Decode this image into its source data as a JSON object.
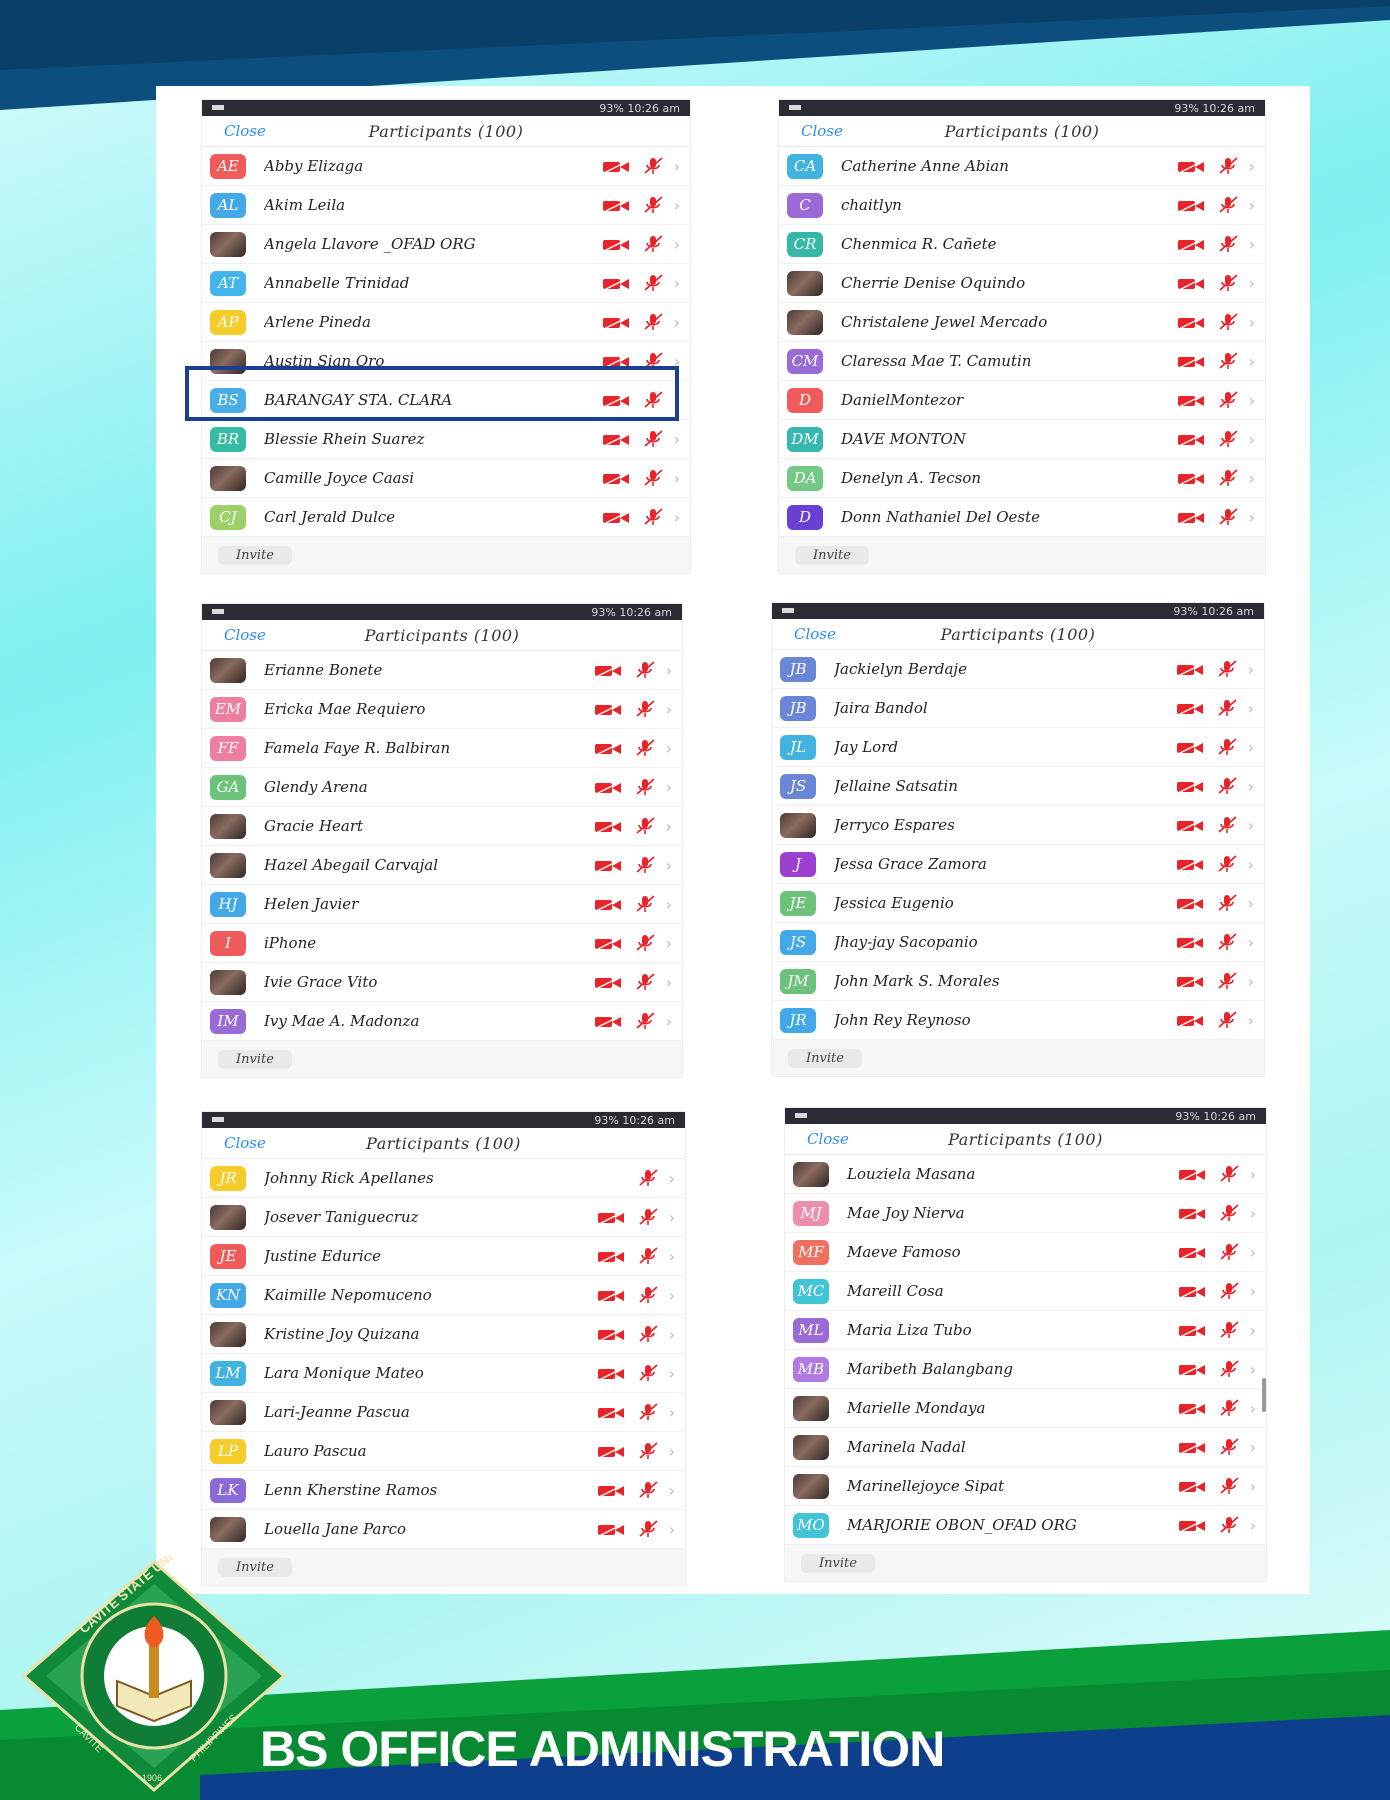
{
  "footer_title": "BS OFFICE ADMINISTRATION",
  "logo": {
    "ring_text_top": "CAVITE STATE UNIVERSITY",
    "ring_text_bottom_left": "CAVITE",
    "ring_text_bottom_right": "PHILIPPINES",
    "year": "1906"
  },
  "colors": {
    "video_icon": "#e8242b",
    "mic_icon": "#e8242b",
    "close_link": "#2d8cf0",
    "highlight_border": "#1b3f8f",
    "status_bar": "#2b2b33"
  },
  "panels": [
    {
      "status": "93% 10:26 am",
      "close_label": "Close",
      "title": "Participants (100)",
      "invite_label": "Invite",
      "participants": [
        {
          "initials": "AE",
          "color": "#ef5b5b",
          "name": "Abby Elizaga",
          "video": true
        },
        {
          "initials": "AL",
          "color": "#42a8e8",
          "name": "Akim Leila",
          "video": true
        },
        {
          "initials": "",
          "color": "photo",
          "name": "Angela Llavore _OFAD ORG",
          "video": true
        },
        {
          "initials": "AT",
          "color": "#42b6ec",
          "name": "Annabelle Trinidad",
          "video": true
        },
        {
          "initials": "AP",
          "color": "#f6cc2b",
          "name": "Arlene Pineda",
          "video": true
        },
        {
          "initials": "",
          "color": "photo",
          "name": "Austin Sian Oro",
          "video": true
        },
        {
          "initials": "BS",
          "color": "#4aaee6",
          "name": "BARANGAY STA. CLARA",
          "video": true
        },
        {
          "initials": "BR",
          "color": "#36bba4",
          "name": "Blessie Rhein Suarez",
          "video": true
        },
        {
          "initials": "",
          "color": "photo",
          "name": "Camille Joyce Caasi",
          "video": true
        },
        {
          "initials": "CJ",
          "color": "#9ed06a",
          "name": "Carl Jerald Dulce",
          "video": true
        }
      ]
    },
    {
      "status": "93% 10:26 am",
      "close_label": "Close",
      "title": "Participants (100)",
      "invite_label": "Invite",
      "participants": [
        {
          "initials": "CA",
          "color": "#42b3e0",
          "name": "Catherine Anne Abian",
          "video": true
        },
        {
          "initials": "C",
          "color": "#9c6ad6",
          "name": "chaitlyn",
          "video": true
        },
        {
          "initials": "CR",
          "color": "#36b8a8",
          "name": "Chenmica R. Cañete",
          "video": true
        },
        {
          "initials": "",
          "color": "photo",
          "name": "Cherrie Denise Oquindo",
          "video": true
        },
        {
          "initials": "",
          "color": "photo",
          "name": "Christalene Jewel Mercado",
          "video": true
        },
        {
          "initials": "CM",
          "color": "#9a6ad6",
          "name": "Claressa Mae T. Camutin",
          "video": true
        },
        {
          "initials": "D",
          "color": "#ef5b5b",
          "name": "DanielMontezor",
          "video": true
        },
        {
          "initials": "DM",
          "color": "#36b8b0",
          "name": "DAVE MONTON",
          "video": true
        },
        {
          "initials": "DA",
          "color": "#76c886",
          "name": "Denelyn A. Tecson",
          "video": true
        },
        {
          "initials": "D",
          "color": "#6a3fd6",
          "name": "Donn Nathaniel Del Oeste",
          "video": true
        }
      ]
    },
    {
      "status": "93% 10:26 am",
      "close_label": "Close",
      "title": "Participants (100)",
      "invite_label": "Invite",
      "participants": [
        {
          "initials": "",
          "color": "photo",
          "name": "Erianne Bonete",
          "video": true
        },
        {
          "initials": "EM",
          "color": "#ee7ea0",
          "name": "Ericka Mae Requiero",
          "video": true
        },
        {
          "initials": "FF",
          "color": "#ee7ea0",
          "name": "Famela Faye R. Balbiran",
          "video": true
        },
        {
          "initials": "GA",
          "color": "#6cc27a",
          "name": "Glendy Arena",
          "video": true
        },
        {
          "initials": "",
          "color": "photo",
          "name": "Gracie Heart",
          "video": true
        },
        {
          "initials": "",
          "color": "photo",
          "name": "Hazel Abegail Carvajal",
          "video": true
        },
        {
          "initials": "HJ",
          "color": "#42a8e8",
          "name": "Helen Javier",
          "video": true
        },
        {
          "initials": "I",
          "color": "#ef5b5b",
          "name": "iPhone",
          "video": true
        },
        {
          "initials": "",
          "color": "photo",
          "name": "Ivie Grace Vito",
          "video": true
        },
        {
          "initials": "IM",
          "color": "#9a6ad6",
          "name": "Ivy Mae A. Madonza",
          "video": true
        }
      ]
    },
    {
      "status": "93% 10:26 am",
      "close_label": "Close",
      "title": "Participants (100)",
      "invite_label": "Invite",
      "participants": [
        {
          "initials": "JB",
          "color": "#6a86d6",
          "name": "Jackielyn Berdaje",
          "video": true
        },
        {
          "initials": "JB",
          "color": "#6a86d6",
          "name": "Jaira Bandol",
          "video": true
        },
        {
          "initials": "JL",
          "color": "#42b3e0",
          "name": "Jay Lord",
          "video": true
        },
        {
          "initials": "JS",
          "color": "#6a86d6",
          "name": "Jellaine Satsatin",
          "video": true
        },
        {
          "initials": "",
          "color": "photo",
          "name": "Jerryco Espares",
          "video": true
        },
        {
          "initials": "J",
          "color": "#9a3fd0",
          "name": "Jessa Grace Zamora",
          "video": true
        },
        {
          "initials": "JE",
          "color": "#6cc27a",
          "name": "Jessica Eugenio",
          "video": true
        },
        {
          "initials": "JS",
          "color": "#42a8e8",
          "name": "Jhay-jay Sacopanio",
          "video": true
        },
        {
          "initials": "JM",
          "color": "#6cc27a",
          "name": "John Mark S. Morales",
          "video": true
        },
        {
          "initials": "JR",
          "color": "#42a8e8",
          "name": "John Rey Reynoso",
          "video": true
        }
      ]
    },
    {
      "status": "93% 10:26 am",
      "close_label": "Close",
      "title": "Participants (100)",
      "invite_label": "Invite",
      "participants": [
        {
          "initials": "JR",
          "color": "#f6cc2b",
          "name": "Johnny Rick Apellanes",
          "video": false
        },
        {
          "initials": "",
          "color": "photo",
          "name": "Josever Taniguecruz",
          "video": true
        },
        {
          "initials": "JE",
          "color": "#ef5b5b",
          "name": "Justine Edurice",
          "video": true
        },
        {
          "initials": "KN",
          "color": "#42a8e8",
          "name": "Kaimille Nepomuceno",
          "video": true
        },
        {
          "initials": "",
          "color": "photo",
          "name": "Kristine Joy Quizana",
          "video": true
        },
        {
          "initials": "LM",
          "color": "#42b3e0",
          "name": "Lara Monique Mateo",
          "video": true
        },
        {
          "initials": "",
          "color": "photo",
          "name": "Lari-Jeanne Pascua",
          "video": true
        },
        {
          "initials": "LP",
          "color": "#f6cc2b",
          "name": "Lauro Pascua",
          "video": true
        },
        {
          "initials": "LK",
          "color": "#8a6ad6",
          "name": "Lenn Kherstine Ramos",
          "video": true
        },
        {
          "initials": "",
          "color": "photo",
          "name": "Louella Jane Parco",
          "video": true
        }
      ]
    },
    {
      "status": "93% 10:26 am",
      "close_label": "Close",
      "title": "Participants (100)",
      "invite_label": "Invite",
      "participants": [
        {
          "initials": "",
          "color": "photo",
          "name": "Louziela Masana",
          "video": true
        },
        {
          "initials": "MJ",
          "color": "#ee8eae",
          "name": "Mae Joy Nierva",
          "video": true
        },
        {
          "initials": "MF",
          "color": "#f07060",
          "name": "Maeve Famoso",
          "video": true
        },
        {
          "initials": "MC",
          "color": "#42c3d6",
          "name": "Mareill Cosa",
          "video": true
        },
        {
          "initials": "ML",
          "color": "#9a6ad6",
          "name": "Maria Liza Tubo",
          "video": true
        },
        {
          "initials": "MB",
          "color": "#b07ae0",
          "name": "Maribeth Balangbang",
          "video": true
        },
        {
          "initials": "",
          "color": "photo",
          "name": "Marielle Mondaya",
          "video": true
        },
        {
          "initials": "",
          "color": "photo",
          "name": "Marinela Nadal",
          "video": true
        },
        {
          "initials": "",
          "color": "photo",
          "name": "Marinellejoyce Sipat",
          "video": true
        },
        {
          "initials": "MO",
          "color": "#42c3d6",
          "name": "MARJORIE OBON_OFAD ORG",
          "video": true
        }
      ]
    }
  ]
}
